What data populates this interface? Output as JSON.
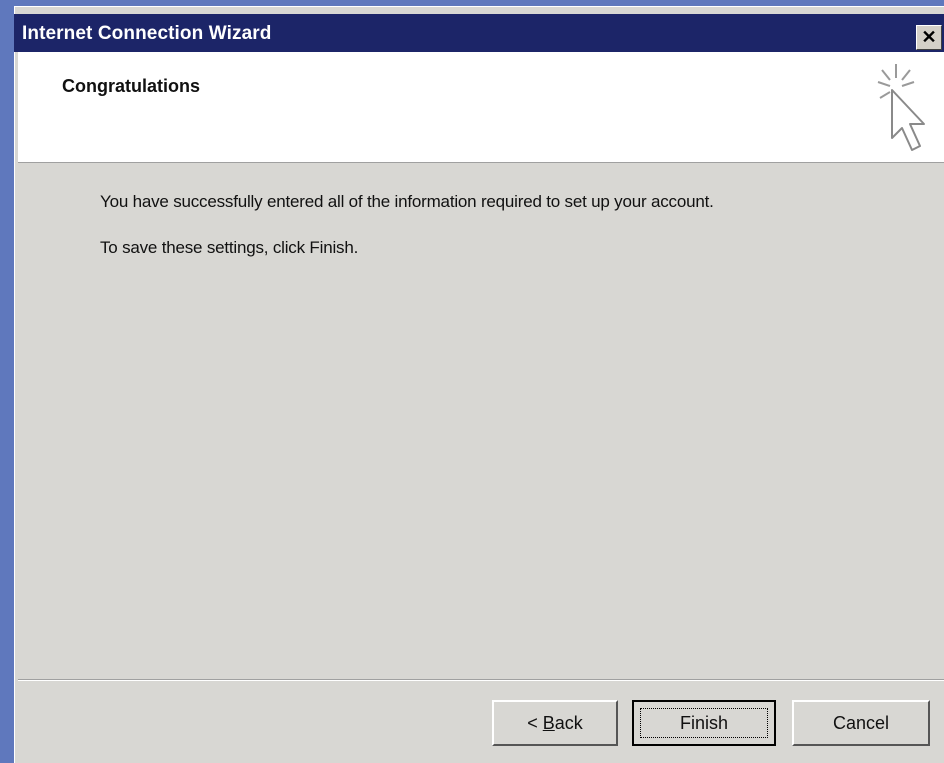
{
  "window": {
    "title": "Internet Connection Wizard",
    "close_label": "✕"
  },
  "header": {
    "title": "Congratulations",
    "icon": "wizard-cursor-sparkle-icon"
  },
  "content": {
    "message1": "You have successfully entered all of the information required to set up your account.",
    "message2": "To save these settings, click Finish."
  },
  "buttons": {
    "back_accel": "B",
    "back_rest": "ack",
    "back_prefix": "< ",
    "finish": "Finish",
    "cancel": "Cancel"
  },
  "colors": {
    "desktop": "#5f78bd",
    "titlebar": "#1c2568",
    "dialog_face": "#d8d7d3"
  }
}
